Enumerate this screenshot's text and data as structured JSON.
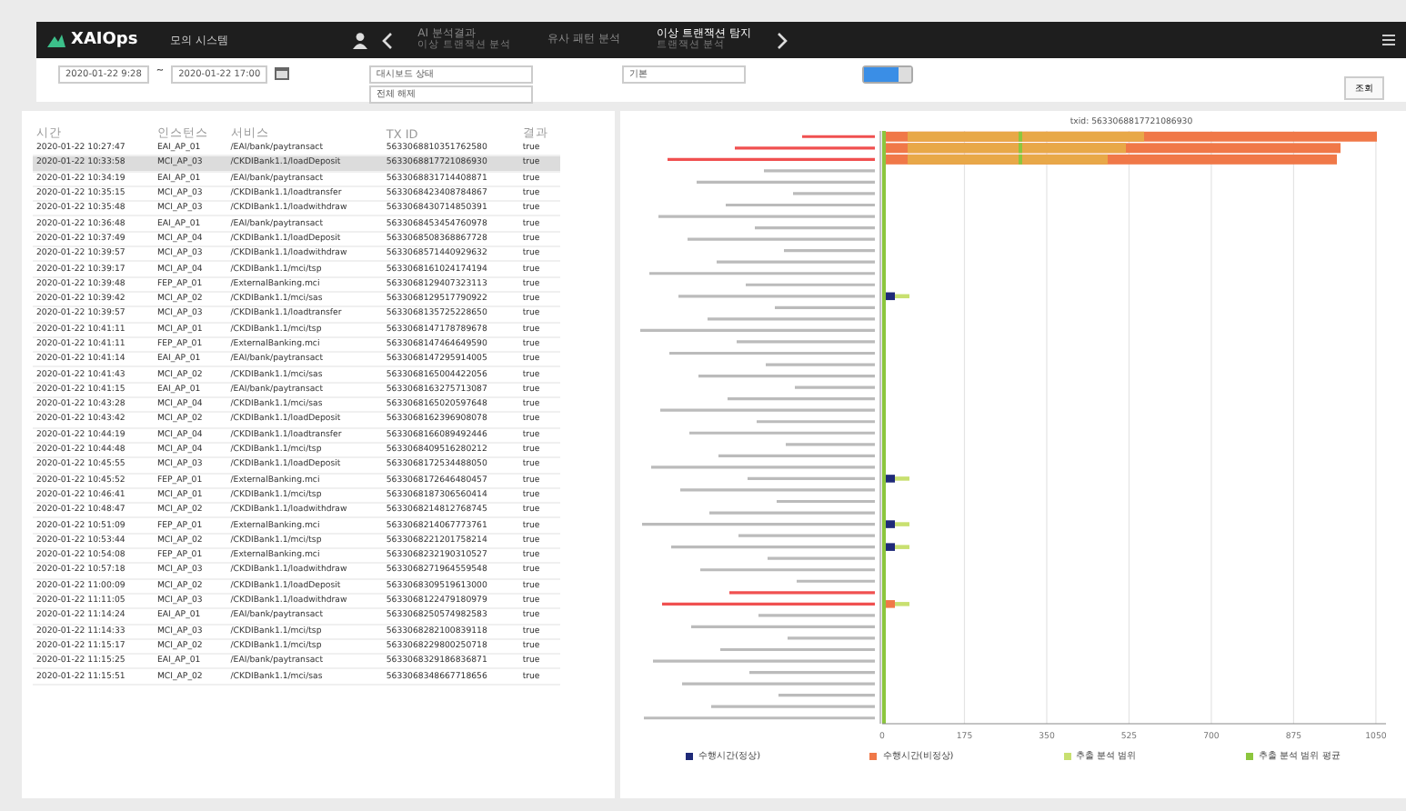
{
  "header": {
    "logo": "XAIOps",
    "system": "모의 시스템",
    "menu": [
      {
        "label": "AI 분석결과",
        "sub": "이상 트랜잭션 분석",
        "selected": false
      },
      {
        "label": "유사 패턴 분석",
        "selected": false
      },
      {
        "label": "이상 트랜잭션 탐지",
        "sub": "트랜잭션 분석",
        "selected": true
      }
    ]
  },
  "filters": {
    "date_from": "2020-01-22 9:28",
    "separator": "~",
    "date_to": "2020-01-22 17:00",
    "status": "대시보드 상태",
    "status_sub": "전체 해제",
    "type": "기본",
    "toggle_on": true,
    "search_button": "조회"
  },
  "table": {
    "columns": [
      "시간",
      "인스턴스",
      "서비스",
      "TX ID",
      "결과"
    ],
    "rows": [
      {
        "cells": [
          "2020-01-22 10:27:47",
          "EAI_AP_01",
          "/EAI/bank/paytransact",
          "5633068810351762580",
          "true"
        ],
        "selected": false
      },
      {
        "cells": [
          "2020-01-22 10:33:58",
          "MCI_AP_03",
          "/CKDIBank1.1/loadDeposit",
          "5633068817721086930",
          "true"
        ],
        "selected": true
      },
      {
        "cells": [
          "2020-01-22 10:34:19",
          "EAI_AP_01",
          "/EAI/bank/paytransact",
          "5633068831714408871",
          "true"
        ],
        "selected": false
      },
      {
        "cells": [
          "2020-01-22 10:35:15",
          "MCI_AP_03",
          "/CKDIBank1.1/loadtransfer",
          "5633068423408784867",
          "true"
        ],
        "selected": false
      },
      {
        "cells": [
          "2020-01-22 10:35:48",
          "MCI_AP_03",
          "/CKDIBank1.1/loadwithdraw",
          "5633068430714850391",
          "true"
        ],
        "selected": false
      },
      {
        "cells": [
          "2020-01-22 10:36:48",
          "EAI_AP_01",
          "/EAI/bank/paytransact",
          "5633068453454760978",
          "true"
        ],
        "selected": false
      },
      {
        "cells": [
          "2020-01-22 10:37:49",
          "MCI_AP_04",
          "/CKDIBank1.1/loadDeposit",
          "5633068508368867728",
          "true"
        ],
        "selected": false
      },
      {
        "cells": [
          "2020-01-22 10:39:57",
          "MCI_AP_03",
          "/CKDIBank1.1/loadwithdraw",
          "5633068571440929632",
          "true"
        ],
        "selected": false
      },
      {
        "cells": [
          "2020-01-22 10:39:17",
          "MCI_AP_04",
          "/CKDIBank1.1/mci/tsp",
          "5633068161024174194",
          "true"
        ],
        "selected": false
      },
      {
        "cells": [
          "2020-01-22 10:39:48",
          "FEP_AP_01",
          "/ExternalBanking.mci",
          "5633068129407323113",
          "true"
        ],
        "selected": false
      },
      {
        "cells": [
          "2020-01-22 10:39:42",
          "MCI_AP_02",
          "/CKDIBank1.1/mci/sas",
          "5633068129517790922",
          "true"
        ],
        "selected": false
      },
      {
        "cells": [
          "2020-01-22 10:39:57",
          "MCI_AP_03",
          "/CKDIBank1.1/loadtransfer",
          "5633068135725228650",
          "true"
        ],
        "selected": false
      },
      {
        "cells": [
          "2020-01-22 10:41:11",
          "MCI_AP_01",
          "/CKDIBank1.1/mci/tsp",
          "5633068147178789678",
          "true"
        ],
        "selected": false
      },
      {
        "cells": [
          "2020-01-22 10:41:11",
          "FEP_AP_01",
          "/ExternalBanking.mci",
          "5633068147464649590",
          "true"
        ],
        "selected": false
      },
      {
        "cells": [
          "2020-01-22 10:41:14",
          "EAI_AP_01",
          "/EAI/bank/paytransact",
          "5633068147295914005",
          "true"
        ],
        "selected": false
      },
      {
        "cells": [
          "2020-01-22 10:41:43",
          "MCI_AP_02",
          "/CKDIBank1.1/mci/sas",
          "5633068165004422056",
          "true"
        ],
        "selected": false
      },
      {
        "cells": [
          "2020-01-22 10:41:15",
          "EAI_AP_01",
          "/EAI/bank/paytransact",
          "5633068163275713087",
          "true"
        ],
        "selected": false
      },
      {
        "cells": [
          "2020-01-22 10:43:28",
          "MCI_AP_04",
          "/CKDIBank1.1/mci/sas",
          "5633068165020597648",
          "true"
        ],
        "selected": false
      },
      {
        "cells": [
          "2020-01-22 10:43:42",
          "MCI_AP_02",
          "/CKDIBank1.1/loadDeposit",
          "5633068162396908078",
          "true"
        ],
        "selected": false
      },
      {
        "cells": [
          "2020-01-22 10:44:19",
          "MCI_AP_04",
          "/CKDIBank1.1/loadtransfer",
          "5633068166089492446",
          "true"
        ],
        "selected": false
      },
      {
        "cells": [
          "2020-01-22 10:44:48",
          "MCI_AP_04",
          "/CKDIBank1.1/mci/tsp",
          "5633068409516280212",
          "true"
        ],
        "selected": false
      },
      {
        "cells": [
          "2020-01-22 10:45:55",
          "MCI_AP_03",
          "/CKDIBank1.1/loadDeposit",
          "5633068172534488050",
          "true"
        ],
        "selected": false
      },
      {
        "cells": [
          "2020-01-22 10:45:52",
          "FEP_AP_01",
          "/ExternalBanking.mci",
          "5633068172646480457",
          "true"
        ],
        "selected": false
      },
      {
        "cells": [
          "2020-01-22 10:46:41",
          "MCI_AP_01",
          "/CKDIBank1.1/mci/tsp",
          "5633068187306560414",
          "true"
        ],
        "selected": false
      },
      {
        "cells": [
          "2020-01-22 10:48:47",
          "MCI_AP_02",
          "/CKDIBank1.1/loadwithdraw",
          "5633068214812768745",
          "true"
        ],
        "selected": false
      },
      {
        "cells": [
          "2020-01-22 10:51:09",
          "FEP_AP_01",
          "/ExternalBanking.mci",
          "5633068214067773761",
          "true"
        ],
        "selected": false
      },
      {
        "cells": [
          "2020-01-22 10:53:44",
          "MCI_AP_02",
          "/CKDIBank1.1/mci/tsp",
          "5633068221201758214",
          "true"
        ],
        "selected": false
      },
      {
        "cells": [
          "2020-01-22 10:54:08",
          "FEP_AP_01",
          "/ExternalBanking.mci",
          "5633068232190310527",
          "true"
        ],
        "selected": false
      },
      {
        "cells": [
          "2020-01-22 10:57:18",
          "MCI_AP_03",
          "/CKDIBank1.1/loadwithdraw",
          "5633068271964559548",
          "true"
        ],
        "selected": false
      },
      {
        "cells": [
          "2020-01-22 11:00:09",
          "MCI_AP_02",
          "/CKDIBank1.1/loadDeposit",
          "5633068309519613000",
          "true"
        ],
        "selected": false
      },
      {
        "cells": [
          "2020-01-22 11:11:05",
          "MCI_AP_03",
          "/CKDIBank1.1/loadwithdraw",
          "5633068122479180979",
          "true"
        ],
        "selected": false
      },
      {
        "cells": [
          "2020-01-22 11:14:24",
          "EAI_AP_01",
          "/EAI/bank/paytransact",
          "5633068250574982583",
          "true"
        ],
        "selected": false
      },
      {
        "cells": [
          "2020-01-22 11:14:33",
          "MCI_AP_03",
          "/CKDIBank1.1/mci/tsp",
          "5633068282100839118",
          "true"
        ],
        "selected": false
      },
      {
        "cells": [
          "2020-01-22 11:15:17",
          "MCI_AP_02",
          "/CKDIBank1.1/mci/tsp",
          "5633068229800250718",
          "true"
        ],
        "selected": false
      },
      {
        "cells": [
          "2020-01-22 11:15:25",
          "EAI_AP_01",
          "/EAI/bank/paytransact",
          "5633068329186836871",
          "true"
        ],
        "selected": false
      },
      {
        "cells": [
          "2020-01-22 11:15:51",
          "MCI_AP_02",
          "/CKDIBank1.1/mci/sas",
          "5633068348667718656",
          "true"
        ],
        "selected": false
      }
    ]
  },
  "chart": {
    "title": "txid: 5633068817721086930",
    "xticks": [
      "0",
      "175",
      "350",
      "525",
      "700",
      "875",
      "1050"
    ],
    "legend": [
      {
        "label": "수행시간(정상)",
        "color": "#1f2a78"
      },
      {
        "label": "수행시간(비정상)",
        "color": "#f07848"
      },
      {
        "label": "추출 분석 범위",
        "color": "#c8e070"
      },
      {
        "label": "추출 분석 범위 평균",
        "color": "#8cc63e"
      }
    ]
  }
}
